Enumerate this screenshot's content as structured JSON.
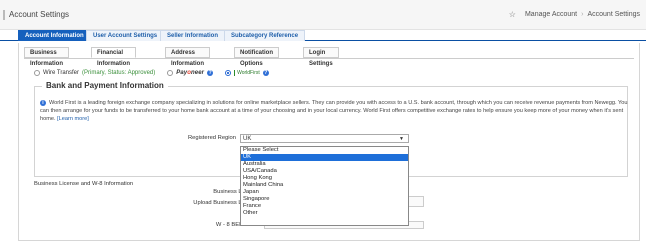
{
  "header": {
    "title": "Account Settings",
    "manage_account": "Manage Account",
    "breadcrumb_sep": "›",
    "breadcrumb_current": "Account Settings"
  },
  "main_tabs": [
    {
      "label": "Account Information",
      "active": true
    },
    {
      "label": "User Account Settings",
      "active": false
    },
    {
      "label": "Seller Information",
      "active": false
    },
    {
      "label": "Subcategory Reference",
      "active": false
    }
  ],
  "sub_tabs": [
    {
      "label": "Business Information",
      "active": false
    },
    {
      "label": "Financial Information",
      "active": true
    },
    {
      "label": "Address Information",
      "active": false
    },
    {
      "label": "Notification Options",
      "active": false
    },
    {
      "label": "Login Settings",
      "active": false
    }
  ],
  "payment_options": {
    "wire": {
      "label": "Wire Transfer",
      "status": "(Primary, Status: Approved)"
    },
    "payoneer": {
      "label_pre": "Pay",
      "label_o": "o",
      "label_post": "neer"
    },
    "worldfirst": {
      "label": "WorldFirst",
      "selected": true
    }
  },
  "bank_section": {
    "legend": "Bank and Payment Information",
    "description": "World First is a leading foreign exchange company specializing in solutions for online marketplace sellers. They can provide you with access to a U.S. bank account, through which you can receive revenue payments from Newegg. You can then arrange for your funds to be transferred to your home bank account at a time of your choosing and in your local currency. World First offers competitive exchange rates to help ensure you keep more of your money when it's sent home.",
    "learn_more": "[Learn more]",
    "region_label": "Registered Region",
    "region_value": "UK",
    "region_options": [
      "Please Select",
      "UK",
      "Australia",
      "USA/Canada",
      "Hong Kong",
      "Mainland China",
      "Japan",
      "Singapore",
      "France",
      "Other"
    ],
    "region_selected_index": 1
  },
  "license_section": {
    "heading": "Business License and W-8 Information",
    "business_license_label": "Business License:",
    "upload_label": "Upload Business License:",
    "w8_label": "W - 8 BEN Form:"
  },
  "colors": {
    "accent": "#1560bd",
    "approved": "#3a8f3a",
    "payoneer_o": "#e43f2d"
  }
}
